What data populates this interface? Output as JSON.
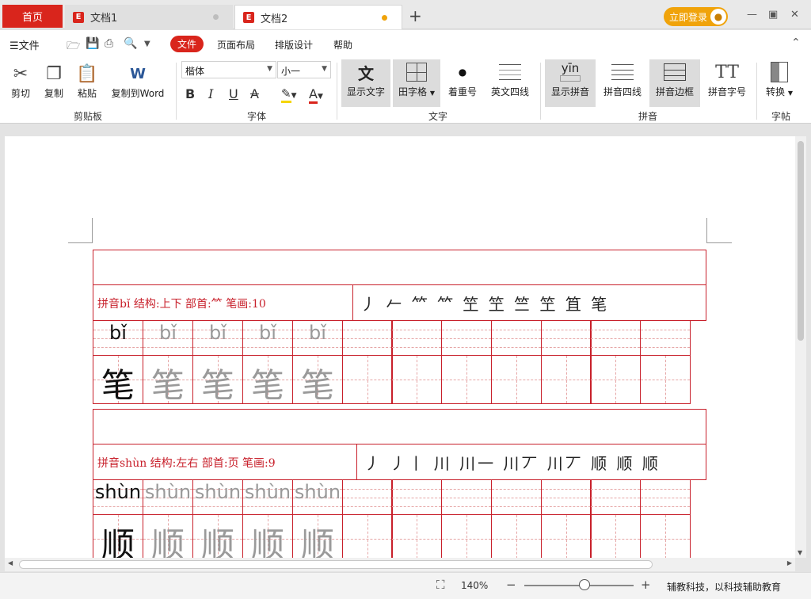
{
  "titlebar": {
    "home_tab": "首页",
    "tabs": [
      {
        "label": "文档1"
      },
      {
        "label": "文档2"
      }
    ],
    "new_tab": "+",
    "login": "立即登录",
    "min": "▭",
    "max": "▣",
    "close": "✕"
  },
  "menubar": {
    "file_menu": "☰文件",
    "items": [
      "文件",
      "页面布局",
      "排版设计",
      "帮助"
    ]
  },
  "ribbon": {
    "clipboard": {
      "cut": "剪切",
      "copy": "复制",
      "paste": "粘贴",
      "copy_word": "复制到Word",
      "group": "剪贴板"
    },
    "font": {
      "family": "楷体",
      "size": "小一",
      "bold": "B",
      "italic": "I",
      "underline": "U",
      "strike": "A",
      "font_color": "A",
      "group": "字体"
    },
    "text": {
      "show_text": "显示文字",
      "grid": "田字格",
      "emphasis": "着重号",
      "en_lines": "英文四线",
      "group": "文字"
    },
    "pinyin": {
      "pinyin_sample": "yīn",
      "show_pinyin": "显示拼音",
      "pinyin_lines": "拼音四线",
      "pinyin_border": "拼音边框",
      "pinyin_size": "拼音字号",
      "group": "拼音"
    },
    "zitie": {
      "convert": "转换",
      "group": "字帖"
    }
  },
  "document": {
    "blocks": [
      {
        "info": "拼音bǐ  结构:上下   部首:⺮   笔画:10",
        "strokes": "丿 𠂉 ⺮ ⺮ 笁 笁 竺 笁 笡 笔",
        "pinyin": "bǐ",
        "char": "笔"
      },
      {
        "info": "拼音shùn  结构:左右   部首:页   笔画:9",
        "strokes": "丿 丿丨 川 川一 川丆 川丆 顺 顺 顺",
        "pinyin": "shùn",
        "char": "顺"
      }
    ]
  },
  "statusbar": {
    "zoom": "140%",
    "zoom_out": "−",
    "zoom_in": "+",
    "zoom_level": 0.55,
    "brand": "辅教科技，以科技辅助教育"
  },
  "colors": {
    "accent": "#d9251c",
    "grid": "#c8202b",
    "login": "#f0a30a"
  }
}
